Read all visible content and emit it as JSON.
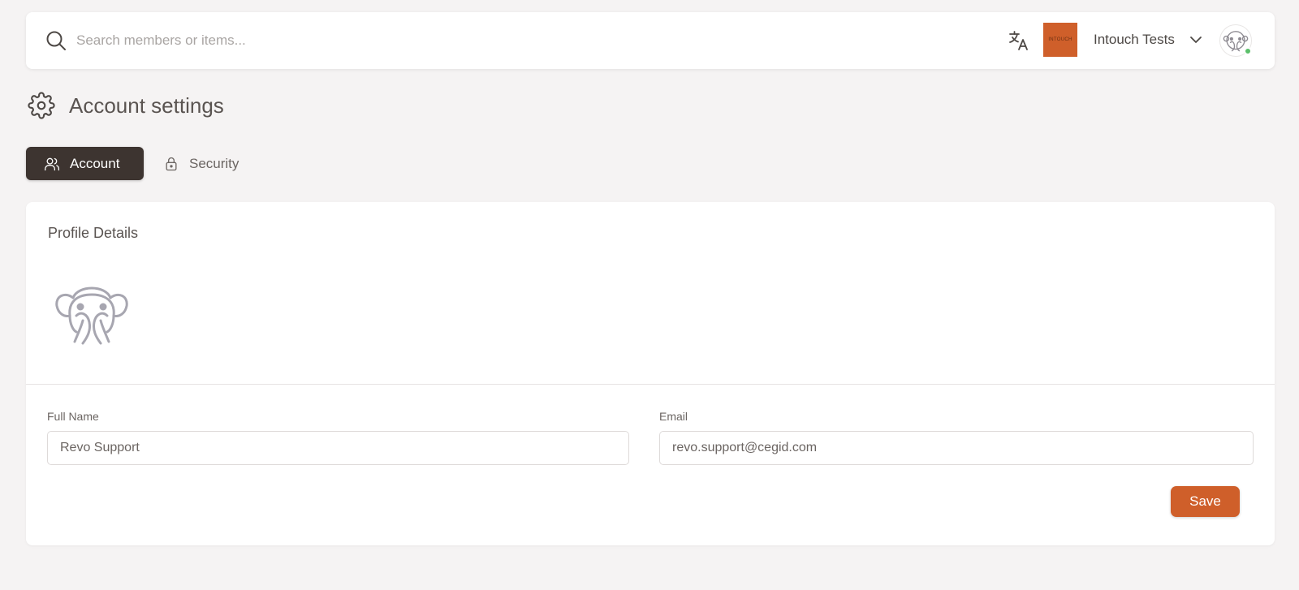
{
  "header": {
    "search_placeholder": "Search members or items...",
    "org_logo_text": "INTOUCH",
    "org_name": "Intouch Tests",
    "icons": [
      "search-icon",
      "translate-icon",
      "chevron-down-icon",
      "monkey-avatar-icon"
    ]
  },
  "page": {
    "title": "Account settings",
    "tabs": [
      {
        "label": "Account",
        "active": true,
        "icon": "users-icon"
      },
      {
        "label": "Security",
        "active": false,
        "icon": "lock-icon"
      }
    ]
  },
  "profile": {
    "section_title": "Profile Details",
    "full_name_label": "Full Name",
    "full_name_value": "Revo Support",
    "email_label": "Email",
    "email_value": "revo.support@cegid.com",
    "save_label": "Save"
  },
  "colors": {
    "accent": "#cf5f2a",
    "tab_active": "#3d3430",
    "online_status": "#5bbf6a",
    "background": "#f5f3f3"
  }
}
